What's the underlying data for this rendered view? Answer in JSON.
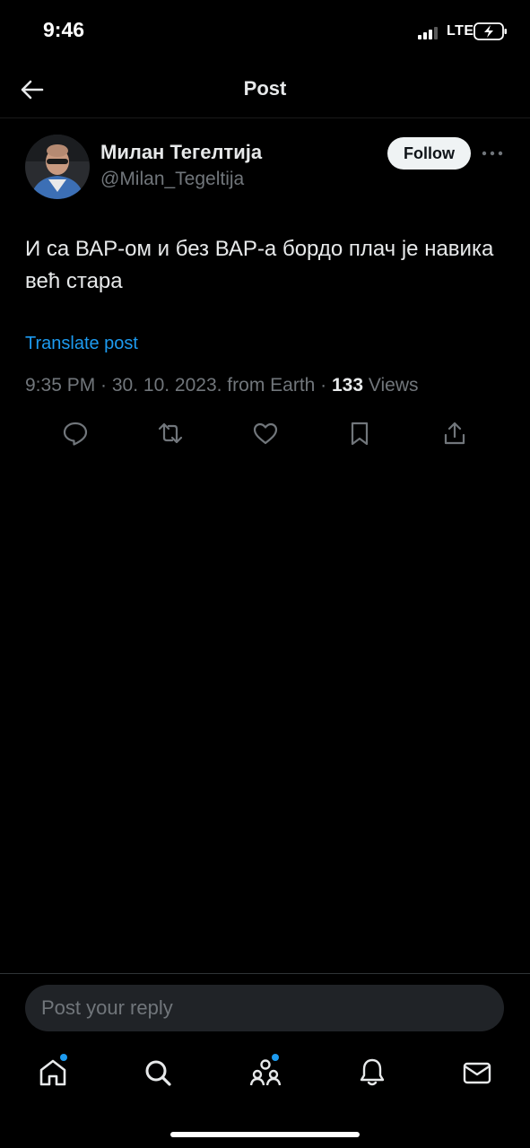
{
  "status_bar": {
    "time": "9:46",
    "network": "LTE"
  },
  "header": {
    "title": "Post"
  },
  "post": {
    "author": {
      "display_name": "Милан Тегелтија",
      "handle": "@Milan_Tegeltija"
    },
    "follow_label": "Follow",
    "text": "И са ВАР-ом и без ВАР-а бордо плач је навика већ стара",
    "translate_label": "Translate post",
    "meta": {
      "timestamp": "9:35 PM · 30. 10. 2023. from Earth · ",
      "views_count": "133",
      "views_label": " Views"
    },
    "actions": [
      "reply-icon",
      "repost-icon",
      "like-icon",
      "bookmark-icon",
      "share-icon"
    ]
  },
  "reply": {
    "placeholder": "Post your reply"
  },
  "bottom_nav": {
    "items": [
      "home-icon",
      "search-icon",
      "communities-icon",
      "notifications-icon",
      "messages-icon"
    ]
  },
  "colors": {
    "background": "#000000",
    "text_primary": "#e7e9ea",
    "text_secondary": "#71767b",
    "accent": "#1d9bf0",
    "follow_bg": "#eff3f4",
    "reply_bg": "#202327"
  }
}
